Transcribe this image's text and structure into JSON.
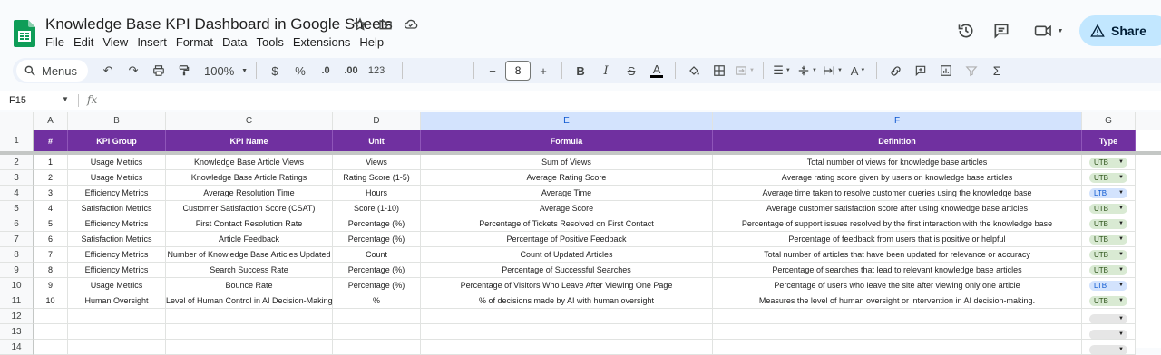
{
  "app": {
    "title": "Knowledge Base KPI Dashboard in Google Sheets",
    "menu": [
      "File",
      "Edit",
      "View",
      "Insert",
      "Format",
      "Data",
      "Tools",
      "Extensions",
      "Help"
    ],
    "share_label": "Share",
    "accent_color": "#c2e7ff",
    "brand_color": "#0f9d58"
  },
  "toolbar": {
    "menus_label": "Menus",
    "zoom": "100%",
    "currency": "$",
    "percent": "%",
    "decrease_decimal": ".0",
    "increase_decimal": ".00",
    "number_format": "123",
    "font_size": "8"
  },
  "formula_bar": {
    "cell_ref": "F15",
    "fx_label": "fx"
  },
  "sheet": {
    "header_color": "#7030a0",
    "columns": [
      "A",
      "B",
      "C",
      "D",
      "E",
      "F",
      "G"
    ],
    "row_numbers": [
      "1",
      "2",
      "3",
      "4",
      "5",
      "6",
      "7",
      "8",
      "9",
      "10",
      "11",
      "12",
      "13",
      "14"
    ],
    "headers": [
      "#",
      "KPI Group",
      "KPI Name",
      "Unit",
      "Formula",
      "Definition",
      "Type"
    ],
    "rows": [
      [
        "1",
        "Usage Metrics",
        "Knowledge Base Article Views",
        "Views",
        "Sum of Views",
        "Total number of views for knowledge base articles",
        "UTB"
      ],
      [
        "2",
        "Usage Metrics",
        "Knowledge Base Article Ratings",
        "Rating Score (1-5)",
        "Average Rating Score",
        "Average rating score given by users on knowledge base articles",
        "UTB"
      ],
      [
        "3",
        "Efficiency Metrics",
        "Average Resolution Time",
        "Hours",
        "Average Time",
        "Average time taken to resolve customer queries using the knowledge base",
        "LTB"
      ],
      [
        "4",
        "Satisfaction Metrics",
        "Customer Satisfaction Score (CSAT)",
        "Score (1-10)",
        "Average Score",
        "Average customer satisfaction score after using knowledge base articles",
        "UTB"
      ],
      [
        "5",
        "Efficiency Metrics",
        "First Contact Resolution Rate",
        "Percentage (%)",
        "Percentage of Tickets Resolved on First Contact",
        "Percentage of support issues resolved by the first interaction with the knowledge base",
        "UTB"
      ],
      [
        "6",
        "Satisfaction Metrics",
        "Article Feedback",
        "Percentage (%)",
        "Percentage of Positive Feedback",
        "Percentage of feedback from users that is positive or helpful",
        "UTB"
      ],
      [
        "7",
        "Efficiency Metrics",
        "Number of Knowledge Base Articles Updated",
        "Count",
        "Count of Updated Articles",
        "Total number of articles that have been updated for relevance or accuracy",
        "UTB"
      ],
      [
        "8",
        "Efficiency Metrics",
        "Search Success Rate",
        "Percentage (%)",
        "Percentage of Successful Searches",
        "Percentage of searches that lead to relevant knowledge base articles",
        "UTB"
      ],
      [
        "9",
        "Usage Metrics",
        "Bounce Rate",
        "Percentage (%)",
        "Percentage of Visitors Who Leave After Viewing One Page",
        "Percentage of users who leave the site after viewing only one article",
        "LTB"
      ],
      [
        "10",
        "Human Oversight",
        "Level of Human Control in AI Decision-Making",
        "%",
        "% of decisions made by AI with human oversight",
        "Measures the level of human oversight or intervention in AI decision-making.",
        "UTB"
      ]
    ]
  }
}
